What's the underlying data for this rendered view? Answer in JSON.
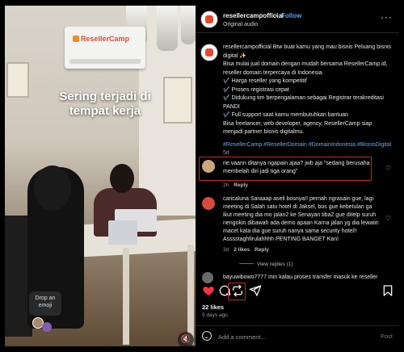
{
  "media": {
    "overlay_text": "Sering terjadi di tempat kerja",
    "ac_brand": "ResellerCamp",
    "drop_emoji": "Drop an emoji"
  },
  "header": {
    "username": "resellercampofficial",
    "separator": "•",
    "follow_label": "Follow",
    "audio_label": "Original audio",
    "more_label": "···"
  },
  "caption": {
    "lines": [
      "resellercampofficial Btw buat kamu yang mau bisnis Peluang bisnis",
      "digital ✨",
      "Bisa mulai jual domain dengan mudah bersama ResellerCamp.id,",
      "reseller domain terpercaya di Indonesia.",
      "✔️ Harga reseller yang kompetitif",
      "✔️ Proses registrasi cepat",
      "✔️ Didukung tim berpengalaman sebagai Registrar terakreditasi",
      "PANDI",
      "✔️ Full support saat kamu membutuhkan bantuan",
      "Bisa freelancer, web developer, agency, ResellerCamp siap",
      "menjadi partner bisnis digitalmu."
    ],
    "hashtags": "#ResellerCamp #ResellerDomain #DomainIndonesia #BisnisDigital",
    "time": "5d"
  },
  "comments": [
    {
      "text_line1": "rie.vaann ditanya ngapain ajaa? jwb aja \"sedang berusaha",
      "text_line2": "membelah diri jadi tiga orang\"",
      "time": "2h",
      "reply": "Reply"
    },
    {
      "lines": [
        "caricaluna Saraaap aseli bosnya!! pernah ngrasain gue, lagi",
        "meeting di Salah satu hotel di Jaksel, bos gue kebetulan ga",
        "ikut meeting dia mo jalan2 ke Senayan tiba2 gue ditelp suruh",
        "nengokin dibawah ada demo apaan Karna jalan yg dia lewatin",
        "macet kata dia gue suruh nanya sama security hotel!!",
        "Asssstaghfirulahhhh PENTING BANGET Kan!"
      ],
      "time": "3d",
      "likes": "2 likes",
      "reply": "Reply",
      "view_replies": "View replies (1)"
    },
    {
      "text": "bayuwibowo7777 min kalau proses transfer masuk ke reseller"
    }
  ],
  "footer": {
    "likes": "22 likes",
    "ago": "5 days ago",
    "comment_placeholder": "Add a comment…",
    "post_label": "Post"
  },
  "colors": {
    "accent": "#4aa3f8",
    "like_red": "#ff3040",
    "highlight": "#c62828"
  }
}
